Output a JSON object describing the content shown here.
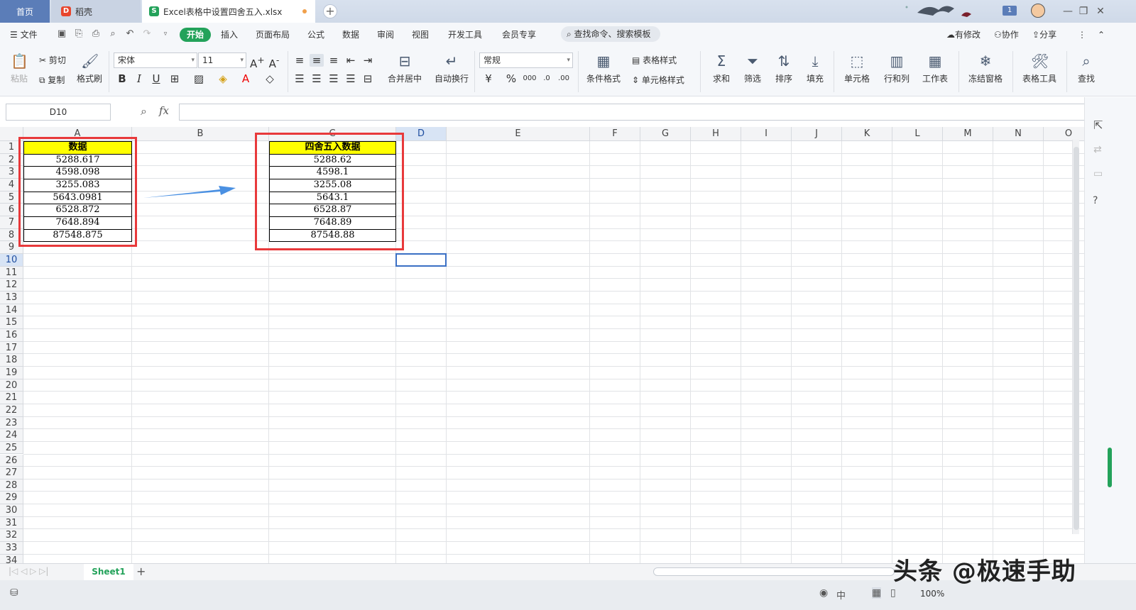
{
  "tabs": {
    "home": "首页",
    "docer": "稻壳",
    "file": "Excel表格中设置四舍五入.xlsx"
  },
  "menu": {
    "file": "文件",
    "items": [
      "开始",
      "插入",
      "页面布局",
      "公式",
      "数据",
      "审阅",
      "视图",
      "开发工具",
      "会员专享"
    ],
    "search": "查找命令、搜索模板",
    "has_changes": "有修改",
    "collab": "协作",
    "share": "分享"
  },
  "ribbon": {
    "paste": "粘贴",
    "cut": "剪切",
    "copy": "复制",
    "format_painter": "格式刷",
    "font_name": "宋体",
    "font_size": "11",
    "merge_center": "合并居中",
    "wrap_text": "自动换行",
    "number_format": "常规",
    "conditional_format": "条件格式",
    "table_style": "表格样式",
    "cell_style": "单元格样式",
    "sum": "求和",
    "filter": "筛选",
    "sort": "排序",
    "fill": "填充",
    "cell": "单元格",
    "row_col": "行和列",
    "worksheet": "工作表",
    "freeze": "冻结窗格",
    "table_tools": "表格工具",
    "find": "查找"
  },
  "formula_bar": {
    "name_box": "D10",
    "fx": "fx",
    "value": ""
  },
  "columns": [
    "A",
    "B",
    "C",
    "D",
    "E",
    "F",
    "G",
    "H",
    "I",
    "J",
    "K",
    "L",
    "M",
    "N",
    "O"
  ],
  "rows": [
    "1",
    "2",
    "3",
    "4",
    "5",
    "6",
    "7",
    "8",
    "9",
    "10",
    "11",
    "12",
    "13",
    "14",
    "15",
    "16",
    "17",
    "18",
    "19",
    "20",
    "21",
    "22",
    "23",
    "24",
    "25",
    "26",
    "27",
    "28",
    "29",
    "30",
    "31",
    "32",
    "33",
    "34"
  ],
  "table_a": {
    "header": "数据",
    "values": [
      "5288.617",
      "4598.098",
      "3255.083",
      "5643.0981",
      "6528.872",
      "7648.894",
      "87548.875"
    ]
  },
  "table_c": {
    "header": "四舍五入数据",
    "values": [
      "5288.62",
      "4598.1",
      "3255.08",
      "5643.1",
      "6528.87",
      "7648.89",
      "87548.88"
    ]
  },
  "sheet": {
    "name": "Sheet1",
    "add": "+"
  },
  "status": {
    "zoom": "100%",
    "input_lang": "中"
  },
  "watermark": "头条 @极速手助",
  "colors": {
    "accent_green": "#23a25a",
    "highlight_red": "#e8393b",
    "arrow_blue": "#4a90e2",
    "header_yellow": "#ffff00"
  }
}
